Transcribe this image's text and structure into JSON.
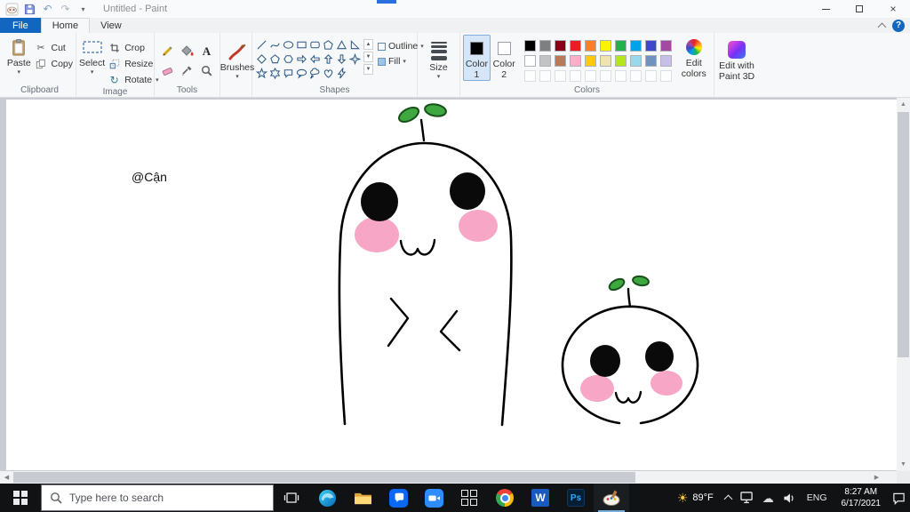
{
  "titlebar": {
    "title": "Untitled - Paint"
  },
  "menu": {
    "file": "File",
    "home": "Home",
    "view": "View"
  },
  "ribbon": {
    "clipboard": {
      "group": "Clipboard",
      "paste": "Paste",
      "cut": "Cut",
      "copy": "Copy"
    },
    "image": {
      "group": "Image",
      "select": "Select",
      "crop": "Crop",
      "resize": "Resize",
      "rotate": "Rotate"
    },
    "tools": {
      "group": "Tools",
      "text_tool": "A"
    },
    "brushes": {
      "label": "Brushes"
    },
    "shapes": {
      "group": "Shapes",
      "outline": "Outline",
      "fill": "Fill",
      "items": [
        "line",
        "curve",
        "oval",
        "rectangle",
        "rounded-rectangle",
        "polygon",
        "triangle",
        "right-triangle",
        "diamond",
        "pentagon",
        "hexagon",
        "right-arrow",
        "left-arrow",
        "up-arrow",
        "down-arrow",
        "four-point-star",
        "five-point-star",
        "six-point-star",
        "rounded-callout",
        "oval-callout",
        "cloud-callout",
        "heart",
        "lightning"
      ]
    },
    "size": {
      "label": "Size"
    },
    "colors": {
      "group": "Colors",
      "color1": "Color 1",
      "color2": "Color 2",
      "edit": "Edit colors",
      "color1_value": "#000000",
      "color2_value": "#ffffff",
      "palette_row1": [
        "#000000",
        "#7f7f7f",
        "#880015",
        "#ed1c24",
        "#ff7f27",
        "#fff200",
        "#22b14c",
        "#00a2e8",
        "#3f48cc",
        "#a349a4"
      ],
      "palette_row2": [
        "#ffffff",
        "#c3c3c3",
        "#b97a57",
        "#ffaec9",
        "#ffc90e",
        "#efe4b0",
        "#b5e61d",
        "#99d9ea",
        "#7092be",
        "#c8bfe7"
      ],
      "empty_slots": 10
    },
    "paint3d": {
      "label": "Edit with Paint 3D"
    }
  },
  "canvas": {
    "annotation": "@Cận"
  },
  "taskbar": {
    "search_placeholder": "Type here to search",
    "weather": "89°F",
    "language": "ENG",
    "time": "8:27 AM",
    "date": "6/17/2021"
  }
}
